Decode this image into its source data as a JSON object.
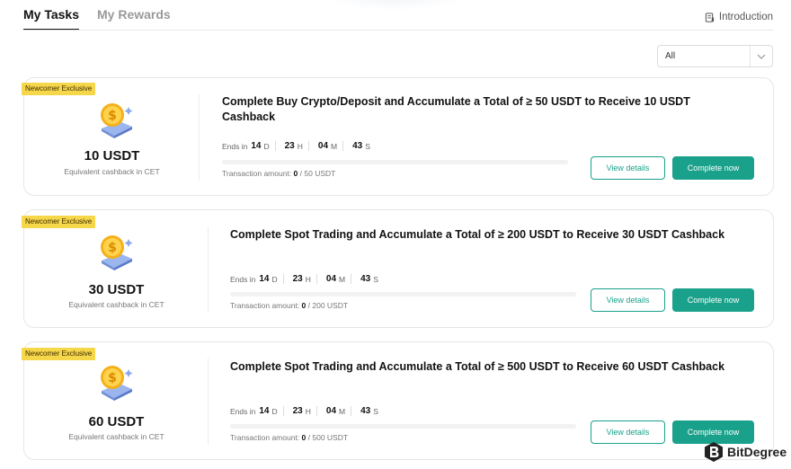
{
  "tabs": [
    {
      "label": "My Tasks",
      "active": true
    },
    {
      "label": "My Rewards",
      "active": false
    }
  ],
  "introduction_label": "Introduction",
  "filter": {
    "selected": "All"
  },
  "tasks": [
    {
      "badge": "Newcomer Exclusive",
      "amount": "10 USDT",
      "equiv": "Equivalent cashback in CET",
      "title_line1": "Complete Buy Crypto/Deposit and Accumulate a Total of ≥ 50 USDT to Receive 10 USDT",
      "title_line2": "Cashback",
      "ends_label": "Ends in",
      "days": "14",
      "d": "D",
      "hours": "23",
      "h": "H",
      "minutes": "04",
      "m": "M",
      "seconds": "43",
      "s": "S",
      "tx_label": "Transaction amount:",
      "tx_current": "0",
      "tx_target": "/ 50 USDT",
      "progress": 0,
      "view_label": "View details",
      "complete_label": "Complete now"
    },
    {
      "badge": "Newcomer Exclusive",
      "amount": "30 USDT",
      "equiv": "Equivalent cashback in CET",
      "title_line1": "Complete Spot Trading and Accumulate a Total of ≥ 200 USDT to Receive 30 USDT Cashback",
      "ends_label": "Ends in",
      "days": "14",
      "d": "D",
      "hours": "23",
      "h": "H",
      "minutes": "04",
      "m": "M",
      "seconds": "43",
      "s": "S",
      "tx_label": "Transaction amount:",
      "tx_current": "0",
      "tx_target": "/ 200 USDT",
      "progress": 0,
      "view_label": "View details",
      "complete_label": "Complete now"
    },
    {
      "badge": "Newcomer Exclusive",
      "amount": "60 USDT",
      "equiv": "Equivalent cashback in CET",
      "title_line1": "Complete Spot Trading and Accumulate a Total of ≥ 500 USDT to Receive 60 USDT Cashback",
      "ends_label": "Ends in",
      "days": "14",
      "d": "D",
      "hours": "23",
      "h": "H",
      "minutes": "04",
      "m": "M",
      "seconds": "43",
      "s": "S",
      "tx_label": "Transaction amount:",
      "tx_current": "0",
      "tx_target": "/ 500 USDT",
      "progress": 0,
      "view_label": "View details",
      "complete_label": "Complete now"
    }
  ],
  "watermark": "BitDegree",
  "colors": {
    "accent": "#1aa18b",
    "badge": "#f7d74a"
  },
  "icons": [
    "document-icon",
    "chevron-down-icon",
    "coin-stack-icon",
    "bitdegree-logo-icon"
  ]
}
